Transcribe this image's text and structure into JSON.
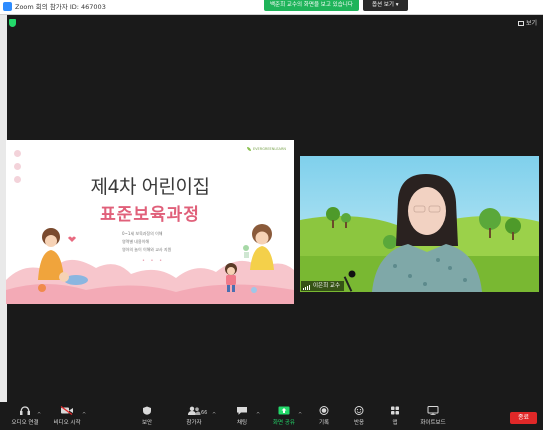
{
  "window": {
    "title": "Zoom 회의 참가자 ID: 467003"
  },
  "banner": {
    "sharing_text": "백준희 교수의 화면을 보고 있습니다",
    "stop_label": "옵션 보기 ▾"
  },
  "view_button": {
    "label": "보기"
  },
  "slide": {
    "logo_text": "EVERGREENLEARN",
    "title_line1": "제4차 어린이집",
    "title_line2": "표준보육과정",
    "bullets": [
      "0~1세 보육과정의 이해",
      "영역별 내용이해",
      "영아의 놀이 이해와 교사 지원"
    ],
    "dots": "• • •"
  },
  "speaker": {
    "name": "이은희 교수"
  },
  "toolbar": {
    "items": [
      {
        "label": "오디오 연결",
        "icon": "headphone-icon"
      },
      {
        "label": "비디오 시작",
        "icon": "video-off-icon"
      },
      {
        "label": "보안",
        "icon": "shield-icon"
      },
      {
        "label": "참가자",
        "icon": "participants-icon"
      },
      {
        "label": "채팅",
        "icon": "chat-icon"
      },
      {
        "label": "화면 공유",
        "icon": "share-screen-icon"
      },
      {
        "label": "기록",
        "icon": "record-icon"
      },
      {
        "label": "반응",
        "icon": "reaction-icon"
      },
      {
        "label": "앱",
        "icon": "apps-icon"
      },
      {
        "label": "화이트보드",
        "icon": "whiteboard-icon"
      }
    ],
    "participant_count": "66",
    "end_label": "종료",
    "share_color": "#23d96a",
    "end_color": "#e02828"
  }
}
